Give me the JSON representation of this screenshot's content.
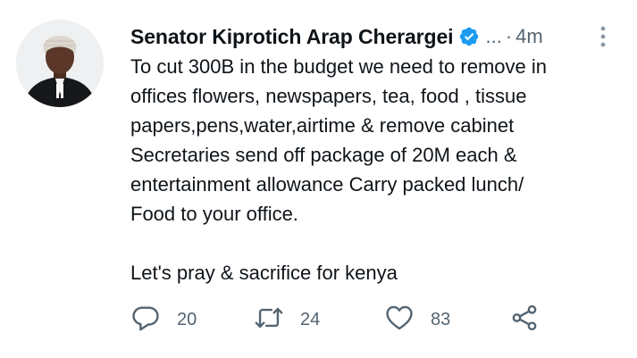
{
  "tweet": {
    "author_name": "Senator Kiprotich Arap Cherargei",
    "handle": "...",
    "separator": "·",
    "time": "4m",
    "body_lines": [
      "To cut 300B in the budget we need to remove in",
      "offices flowers, newspapers, tea, food , tissue",
      "papers,pens,water,airtime & remove cabinet",
      "Secretaries send off package of 20M each &",
      "entertainment allowance Carry packed lunch/",
      "Food to your office."
    ],
    "body_closing": "Let's pray & sacrifice for kenya",
    "stats": {
      "replies": "20",
      "retweets": "24",
      "likes": "83"
    }
  },
  "icons": {
    "verified": "verified-badge-icon",
    "more": "more-vertical-icon",
    "reply": "reply-icon",
    "retweet": "retweet-icon",
    "like": "heart-icon",
    "share": "share-icon"
  },
  "colors": {
    "text": "#0f1419",
    "secondary": "#536471",
    "verified": "#1d9bf0"
  }
}
